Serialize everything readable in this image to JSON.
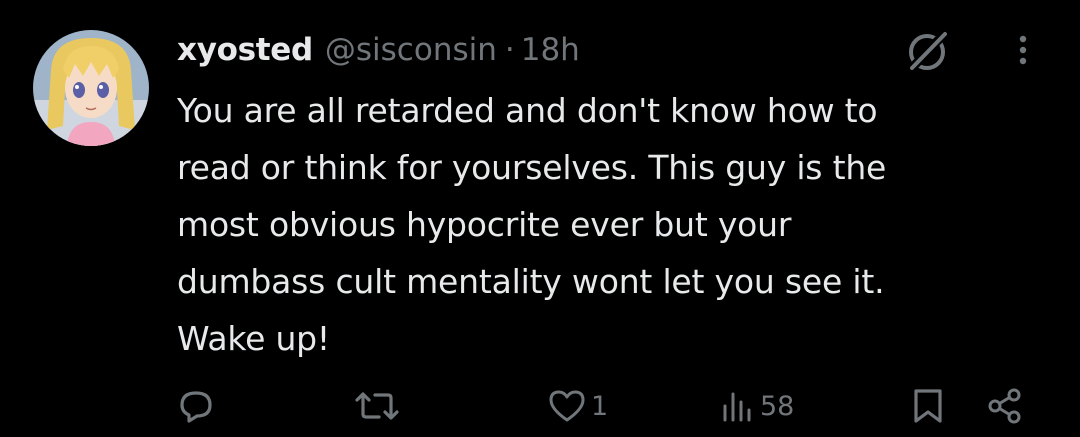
{
  "tweet": {
    "author": {
      "display_name": "xyosted",
      "handle": "@sisconsin",
      "avatar_icon": "anime-girl-avatar"
    },
    "separator": "·",
    "timestamp": "18h",
    "text": "You are all retarded and don't know how to\nread or think for yourselves. This guy is the\nmost obvious hypocrite ever but your\ndumbass cult mentality wont let you see it.\nWake up!",
    "header_icons": {
      "grok": "grok-icon",
      "more": "more-options-icon"
    },
    "actions": {
      "reply": {
        "icon": "reply-icon",
        "count": ""
      },
      "retweet": {
        "icon": "retweet-icon",
        "count": ""
      },
      "like": {
        "icon": "heart-icon",
        "count": "1"
      },
      "views": {
        "icon": "views-icon",
        "count": "58"
      },
      "bookmark": {
        "icon": "bookmark-icon"
      },
      "share": {
        "icon": "share-icon"
      }
    }
  },
  "colors": {
    "background": "#000000",
    "primary_text": "#e7e9ea",
    "secondary_text": "#71767b"
  }
}
